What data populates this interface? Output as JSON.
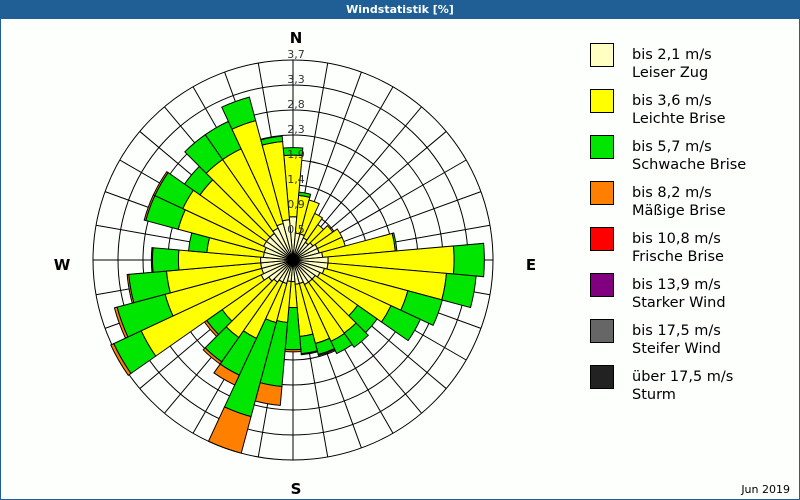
{
  "title": "Windstatistik [%]",
  "date": "Jun 2019",
  "chart_data": {
    "type": "polar-stacked-bar",
    "title": "Windstatistik [%]",
    "unit": "%",
    "rmax": 3.7,
    "ring_labels": [
      "0,5",
      "0,9",
      "1,4",
      "1,9",
      "2,3",
      "2,8",
      "3,3",
      "3,7"
    ],
    "compass": {
      "N": "N",
      "E": "E",
      "S": "S",
      "W": "W"
    },
    "directions_deg": [
      0,
      10,
      20,
      30,
      40,
      50,
      60,
      70,
      80,
      90,
      100,
      110,
      120,
      130,
      140,
      150,
      160,
      170,
      180,
      190,
      200,
      210,
      220,
      230,
      240,
      250,
      260,
      270,
      280,
      290,
      300,
      310,
      320,
      330,
      340,
      350
    ],
    "cumulative": [
      [
        0.8,
        1.94,
        2.08
      ],
      [
        0.5,
        1.2,
        1.26
      ],
      [
        0.5,
        1.15
      ],
      [
        0.45,
        0.95
      ],
      [
        0.4,
        0.8
      ],
      [
        0.45,
        0.9
      ],
      [
        0.5,
        1.0
      ],
      [
        0.5,
        1.0
      ],
      [
        0.55,
        1.9,
        1.93
      ],
      [
        0.65,
        2.98,
        3.54
      ],
      [
        0.65,
        2.85,
        3.4
      ],
      [
        0.6,
        2.2,
        2.86
      ],
      [
        0.55,
        2.0,
        2.6
      ],
      [
        0.5,
        1.46,
        1.9
      ],
      [
        0.5,
        1.65,
        1.97
      ],
      [
        0.5,
        1.66,
        1.91
      ],
      [
        0.45,
        1.6,
        1.81,
        1.83
      ],
      [
        0.45,
        1.42,
        1.74,
        1.76
      ],
      [
        0.4,
        0.88,
        1.66,
        1.7
      ],
      [
        0.4,
        1.16,
        2.35,
        2.7
      ],
      [
        0.45,
        1.2,
        3.0,
        3.7
      ],
      [
        0.45,
        1.6,
        2.35,
        2.55
      ],
      [
        0.5,
        1.75,
        2.3,
        2.35
      ],
      [
        0.55,
        1.6,
        1.95,
        2.0
      ],
      [
        0.65,
        3.1,
        3.66,
        3.72
      ],
      [
        0.6,
        2.45,
        3.37,
        3.42
      ],
      [
        0.6,
        2.35,
        3.05,
        3.08
      ],
      [
        0.6,
        2.12,
        2.6,
        2.62
      ],
      [
        0.55,
        1.6,
        1.94
      ],
      [
        0.55,
        2.2,
        2.82,
        2.85
      ],
      [
        0.6,
        2.25,
        2.82,
        2.85
      ],
      [
        0.6,
        2.1,
        2.45
      ],
      [
        0.6,
        2.27,
        2.83
      ],
      [
        0.65,
        2.27,
        2.83
      ],
      [
        0.7,
        2.67,
        3.12
      ],
      [
        0.75,
        2.2,
        2.3
      ]
    ],
    "classes": [
      {
        "range": "bis 2,1 m/s",
        "name": "Leiser Zug",
        "color": "#ffffc4"
      },
      {
        "range": "bis 3,6 m/s",
        "name": "Leichte Brise",
        "color": "#ffff00"
      },
      {
        "range": "bis 5,7 m/s",
        "name": "Schwache Brise",
        "color": "#00e600"
      },
      {
        "range": "bis 8,2 m/s",
        "name": "Mäßige Brise",
        "color": "#ff8000"
      },
      {
        "range": "bis 10,8 m/s",
        "name": "Frische Brise",
        "color": "#ff0000"
      },
      {
        "range": "bis 13,9 m/s",
        "name": "Starker Wind",
        "color": "#800080"
      },
      {
        "range": "bis 17,5 m/s",
        "name": "Steifer Wind",
        "color": "#666666"
      },
      {
        "range": "über 17,5 m/s",
        "name": "Sturm",
        "color": "#222222"
      }
    ]
  }
}
